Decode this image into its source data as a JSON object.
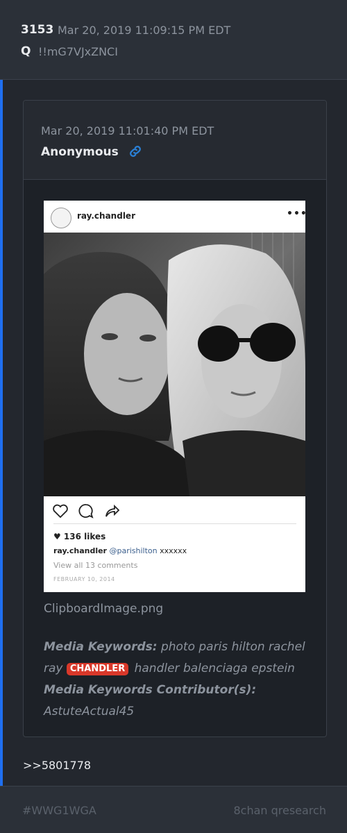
{
  "post": {
    "number": "3153",
    "date": "Mar 20, 2019 11:09:15 PM EDT",
    "author": "Q",
    "tripcode": "!!mG7VJxZNCI"
  },
  "quote": {
    "date": "Mar 20, 2019 11:01:40 PM EDT",
    "author": "Anonymous",
    "icons": {
      "link": "link-icon"
    },
    "image": {
      "username": "ray.chandler",
      "more": "•••",
      "likes": "♥ 136 likes",
      "caption_user": "ray.chandler",
      "caption_mention": "@parishilton",
      "caption_text": "xxxxxx",
      "comments": "View all 13 comments",
      "date": "FEBRUARY 10, 2014",
      "icons": [
        "heart-icon",
        "comment-icon",
        "share-icon"
      ]
    },
    "filename": "ClipboardImage.png",
    "keywords_label": "Media Keywords:",
    "keywords_before": "photo paris hilton rachel ray",
    "keywords_badge": "CHANDLER",
    "keywords_after": "handler balenciaga epstein",
    "contributors_label": "Media Keywords Contributor(s):",
    "contributors": "AstuteActual45"
  },
  "reply_ref": ">>5801778",
  "footer": {
    "hashtag": "#WWG1WGA",
    "source": "8chan qresearch"
  },
  "colors": {
    "accent": "#1f6ff0",
    "badge": "#d9382a",
    "link_icon": "#2a7fd4"
  }
}
